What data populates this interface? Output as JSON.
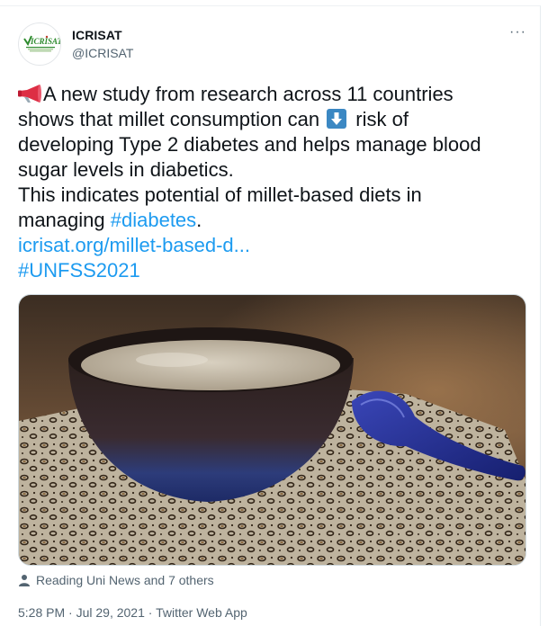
{
  "tweet": {
    "author": {
      "name": "ICRISAT",
      "handle": "@ICRISAT",
      "avatar_logo_text": "ICRISAT",
      "avatar_icon": "icrisat-logo"
    },
    "more_icon": "more-horizontal-icon",
    "more_label": "···",
    "text_lines": [
      {
        "before": "A new study from research across 11 countries",
        "emoji": "megaphone-icon"
      },
      {
        "before": "shows that millet consumption can ",
        "emoji_inline": "down-arrow-icon",
        "after": " risk of"
      },
      {
        "before": "developing Type 2 diabetes and helps manage blood"
      },
      {
        "before": "sugar levels in diabetics."
      },
      {
        "before": "This indicates potential of millet-based diets in"
      },
      {
        "before": "managing ",
        "hashtag": "#diabetes",
        "after": "."
      }
    ],
    "link": "icrisat.org/millet-based-d...",
    "hashtag_line": "#UNFSS2021",
    "tagged": {
      "icon": "person-icon",
      "text": "Reading Uni News and 7 others"
    },
    "meta": {
      "time": "5:28 PM",
      "separator": "·",
      "date": "Jul 29, 2021",
      "source": "Twitter Web App"
    },
    "colors": {
      "link": "#1d9bf0",
      "text": "#0f1419",
      "secondary": "#536471",
      "icrisat_green": "#2e8b2e",
      "icrisat_red": "#c0392b"
    }
  }
}
